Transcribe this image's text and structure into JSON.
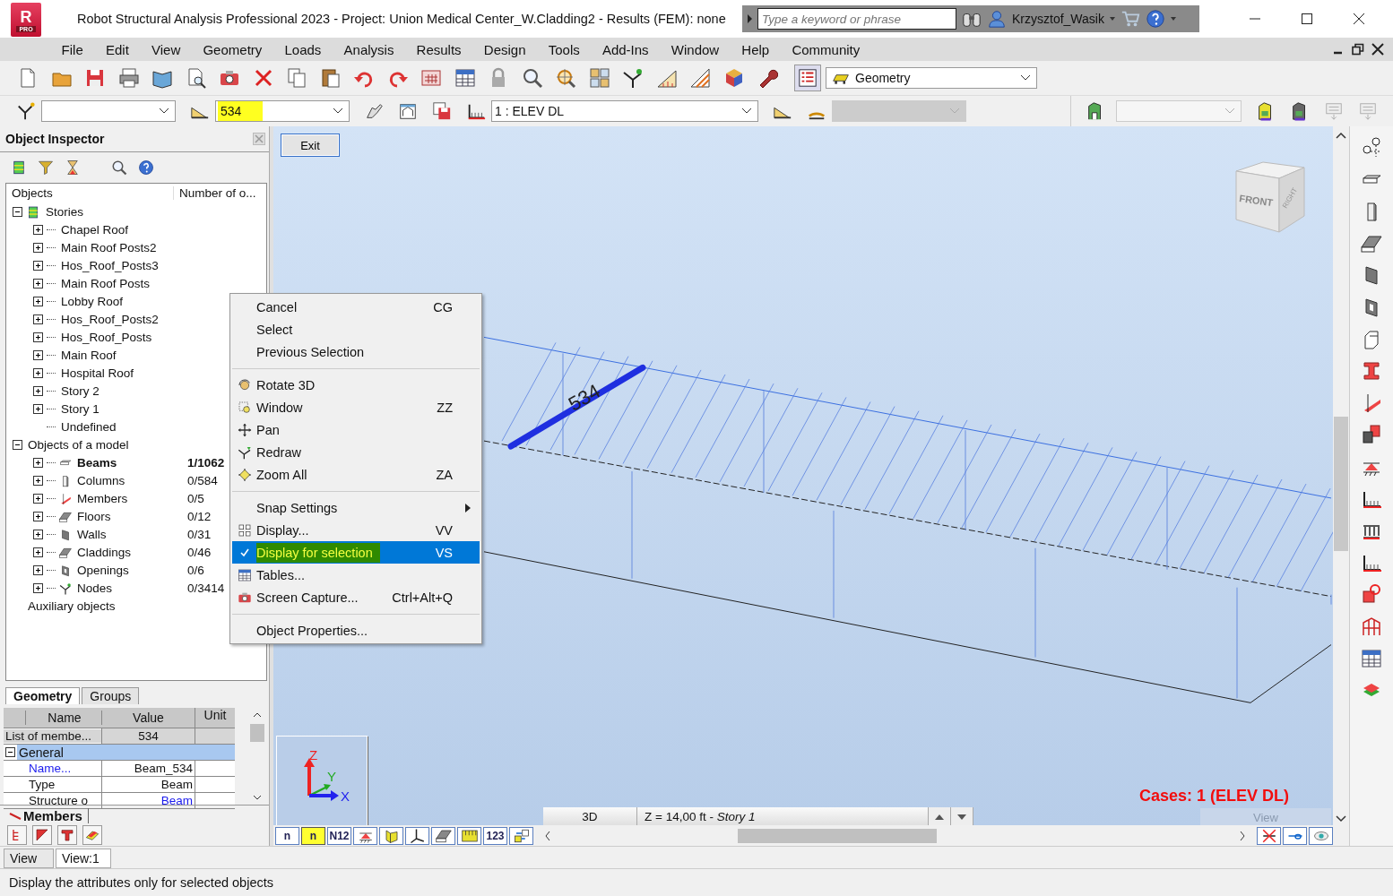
{
  "window": {
    "title": "Robot Structural Analysis Professional 2023 - Project: Union Medical Center_W.Cladding2 - Results (FEM): none",
    "logo_letter": "R",
    "logo_badge": "PRO"
  },
  "search": {
    "placeholder": "Type a keyword or phrase"
  },
  "user": {
    "name": "Krzysztof_Wasik"
  },
  "menu": [
    "File",
    "Edit",
    "View",
    "Geometry",
    "Loads",
    "Analysis",
    "Results",
    "Design",
    "Tools",
    "Add-Ins",
    "Window",
    "Help",
    "Community"
  ],
  "view_type": {
    "value": "Geometry"
  },
  "selection_field": {
    "value": "534",
    "highlighted": true
  },
  "case_field": {
    "value": "1 : ELEV DL"
  },
  "inspector": {
    "title": "Object Inspector",
    "columns": [
      "Objects",
      "Number of o..."
    ],
    "tree": [
      {
        "label": "Stories",
        "expanded": true,
        "children": [
          {
            "label": "Chapel Roof",
            "expanded": false
          },
          {
            "label": "Main Roof Posts2",
            "expanded": false
          },
          {
            "label": "Hos_Roof_Posts3",
            "expanded": false
          },
          {
            "label": "Main Roof Posts",
            "expanded": false
          },
          {
            "label": "Lobby Roof",
            "expanded": false
          },
          {
            "label": "Hos_Roof_Posts2",
            "expanded": false
          },
          {
            "label": "Hos_Roof_Posts",
            "expanded": false
          },
          {
            "label": "Main Roof",
            "expanded": false
          },
          {
            "label": "Hospital Roof",
            "expanded": false
          },
          {
            "label": "Story 2",
            "expanded": false
          },
          {
            "label": "Story 1",
            "expanded": false
          },
          {
            "label": "Undefined"
          }
        ]
      },
      {
        "label": "Objects of a model",
        "expanded": true,
        "children": [
          {
            "label": "Beams",
            "count": "1/1062",
            "kind": "beam",
            "expanded": false,
            "has_selection": true
          },
          {
            "label": "Columns",
            "count": "0/584",
            "kind": "column",
            "expanded": false,
            "has_selection": false
          },
          {
            "label": "Members",
            "count": "0/5",
            "kind": "member",
            "expanded": false,
            "has_selection": false
          },
          {
            "label": "Floors",
            "count": "0/12",
            "kind": "floor",
            "expanded": false,
            "has_selection": false
          },
          {
            "label": "Walls",
            "count": "0/31",
            "kind": "wall",
            "expanded": false,
            "has_selection": false
          },
          {
            "label": "Claddings",
            "count": "0/46",
            "kind": "cladding",
            "expanded": false,
            "has_selection": false
          },
          {
            "label": "Openings",
            "count": "0/6",
            "kind": "opening",
            "expanded": false,
            "has_selection": false
          },
          {
            "label": "Nodes",
            "count": "0/3414",
            "kind": "node",
            "expanded": false,
            "has_selection": false
          }
        ]
      },
      {
        "label": "Auxiliary objects"
      }
    ],
    "tabs": [
      {
        "label": "Geometry",
        "selected": true
      },
      {
        "label": "Groups",
        "selected": false
      }
    ]
  },
  "properties": {
    "columns": [
      "Name",
      "Value",
      "Unit"
    ],
    "rows": [
      {
        "kind": "field",
        "name": "List of membe...",
        "value": "534"
      },
      {
        "kind": "group",
        "name": "General",
        "expanded": true
      },
      {
        "kind": "property",
        "name": "Name...",
        "value": "Beam_534",
        "name_link": true,
        "value_link": false
      },
      {
        "kind": "property",
        "name": "Type",
        "value": "Beam",
        "name_link": false,
        "value_link": false
      },
      {
        "kind": "property",
        "name": "Structure o",
        "value": "Beam",
        "name_link": false,
        "value_link": true
      }
    ]
  },
  "members_tab": {
    "label": "Members"
  },
  "context_menu": [
    {
      "kind": "item",
      "label": "Cancel",
      "shortcut": "CG",
      "selected": false,
      "checked": false,
      "highlighted": false
    },
    {
      "kind": "item",
      "label": "Select",
      "selected": false,
      "checked": false,
      "highlighted": false
    },
    {
      "kind": "item",
      "label": "Previous Selection",
      "selected": false,
      "checked": false,
      "highlighted": false
    },
    {
      "kind": "separator"
    },
    {
      "kind": "item",
      "label": "Rotate 3D",
      "selected": false,
      "checked": false,
      "highlighted": false
    },
    {
      "kind": "item",
      "label": "Window",
      "shortcut": "ZZ",
      "selected": false,
      "checked": false,
      "highlighted": false
    },
    {
      "kind": "item",
      "label": "Pan",
      "selected": false,
      "checked": false,
      "highlighted": false
    },
    {
      "kind": "item",
      "label": "Redraw",
      "selected": false,
      "checked": false,
      "highlighted": false
    },
    {
      "kind": "item",
      "label": "Zoom All",
      "shortcut": "ZA",
      "selected": false,
      "checked": false,
      "highlighted": false
    },
    {
      "kind": "separator"
    },
    {
      "kind": "submenu",
      "label": "Snap Settings",
      "selected": false,
      "checked": false,
      "highlighted": false
    },
    {
      "kind": "item",
      "label": "Display...",
      "shortcut": "VV",
      "selected": false,
      "checked": false,
      "highlighted": false
    },
    {
      "kind": "item",
      "label": "Display for selection",
      "shortcut": "VS",
      "selected": true,
      "checked": true,
      "highlighted": true
    },
    {
      "kind": "item",
      "label": "Tables...",
      "selected": false,
      "checked": false,
      "highlighted": false
    },
    {
      "kind": "item",
      "label": "Screen Capture...",
      "shortcut": "Ctrl+Alt+Q",
      "selected": false,
      "checked": false,
      "highlighted": false
    },
    {
      "kind": "separator"
    },
    {
      "kind": "item",
      "label": "Object Properties...",
      "selected": false,
      "checked": false,
      "highlighted": false
    }
  ],
  "viewport": {
    "exit_button": "Exit",
    "beam_label": "534",
    "cube_faces": [
      "FRONT",
      "RIGHT"
    ],
    "axes": [
      "Z",
      "Y",
      "X"
    ],
    "cases": "Cases: 1 (ELEV DL)",
    "view_mode": "3D",
    "level": "Z = 14,00 ft - *Story 1*",
    "view_button": {
      "label": "View",
      "disabled": true
    }
  },
  "attribute_toolbar": [
    {
      "kind": "text",
      "label": "n",
      "selected": false
    },
    {
      "kind": "text",
      "label": "n",
      "selected": true
    },
    {
      "kind": "text",
      "label": "N12",
      "selected": false
    },
    {
      "kind": "icon",
      "selected": false
    },
    {
      "kind": "icon",
      "selected": false
    },
    {
      "kind": "icon",
      "selected": false
    },
    {
      "kind": "icon",
      "selected": false
    },
    {
      "kind": "icon",
      "selected": false
    },
    {
      "kind": "text",
      "label": "123",
      "selected": false
    },
    {
      "kind": "icon",
      "selected": false
    }
  ],
  "view_tabs": [
    {
      "label": "View",
      "selected": false
    },
    {
      "label": "View:1",
      "selected": true
    }
  ],
  "status_bar": {
    "text": "Display the attributes only for selected objects"
  }
}
